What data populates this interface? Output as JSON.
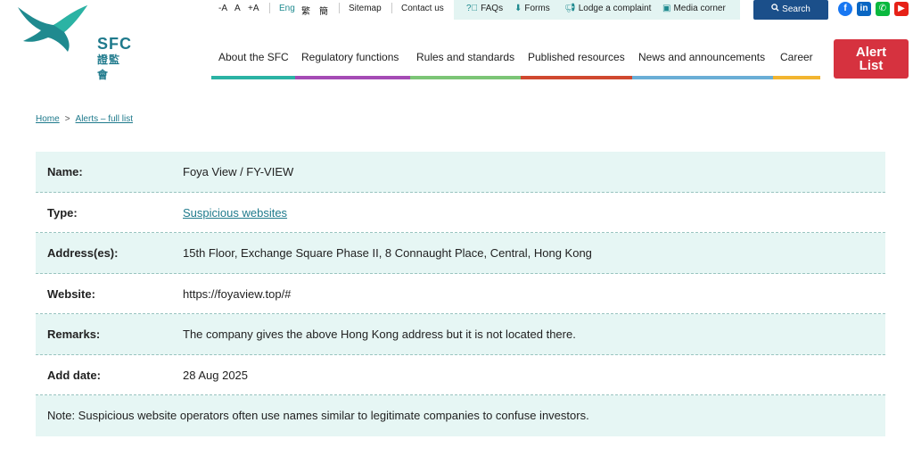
{
  "logo": {
    "name": "SFC",
    "name_zh": "證監會"
  },
  "utility": {
    "font_smaller": "-A",
    "font_normal": "A",
    "font_larger": "+A",
    "lang_eng": "Eng",
    "lang_tc": "繁",
    "lang_sc": "簡",
    "sitemap": "Sitemap",
    "contact": "Contact us"
  },
  "quick_links": {
    "faqs": "FAQs",
    "forms": "Forms",
    "complaint": "Lodge a complaint",
    "media": "Media corner"
  },
  "search": {
    "label": "Search"
  },
  "social": {
    "facebook": "f",
    "linkedin": "in",
    "wechat": "✆",
    "youtube": "▶"
  },
  "nav": {
    "items": [
      {
        "label": "About the SFC",
        "color": "#2bb3a4"
      },
      {
        "label": "Regulatory functions",
        "color": "#a54bb5"
      },
      {
        "label": "Rules and standards",
        "color": "#7cc576"
      },
      {
        "label": "Published resources",
        "color": "#d0482f"
      },
      {
        "label": "News and announcements",
        "color": "#6aaed6"
      },
      {
        "label": "Career",
        "color": "#f2b530"
      }
    ]
  },
  "alert_button": {
    "line1": "Alert",
    "line2": "List",
    "color": "#d6323f"
  },
  "breadcrumb": {
    "home": "Home",
    "sep": ">",
    "current": "Alerts – full list"
  },
  "alert_detail": {
    "rows": [
      {
        "label": "Name:",
        "value": "Foya View / FY-VIEW"
      },
      {
        "label": "Type:",
        "value": "Suspicious websites"
      },
      {
        "label": "Address(es):",
        "value": "15th Floor, Exchange Square Phase II, 8 Connaught Place, Central, Hong Kong"
      },
      {
        "label": "Website:",
        "value": "https://foyaview.top/#"
      },
      {
        "label": "Remarks:",
        "value": "The company gives the above Hong Kong address but it is not located there."
      },
      {
        "label": "Add date:",
        "value": "28 Aug 2025"
      }
    ],
    "note": "Note: Suspicious website operators often use names similar to legitimate companies to confuse investors."
  }
}
